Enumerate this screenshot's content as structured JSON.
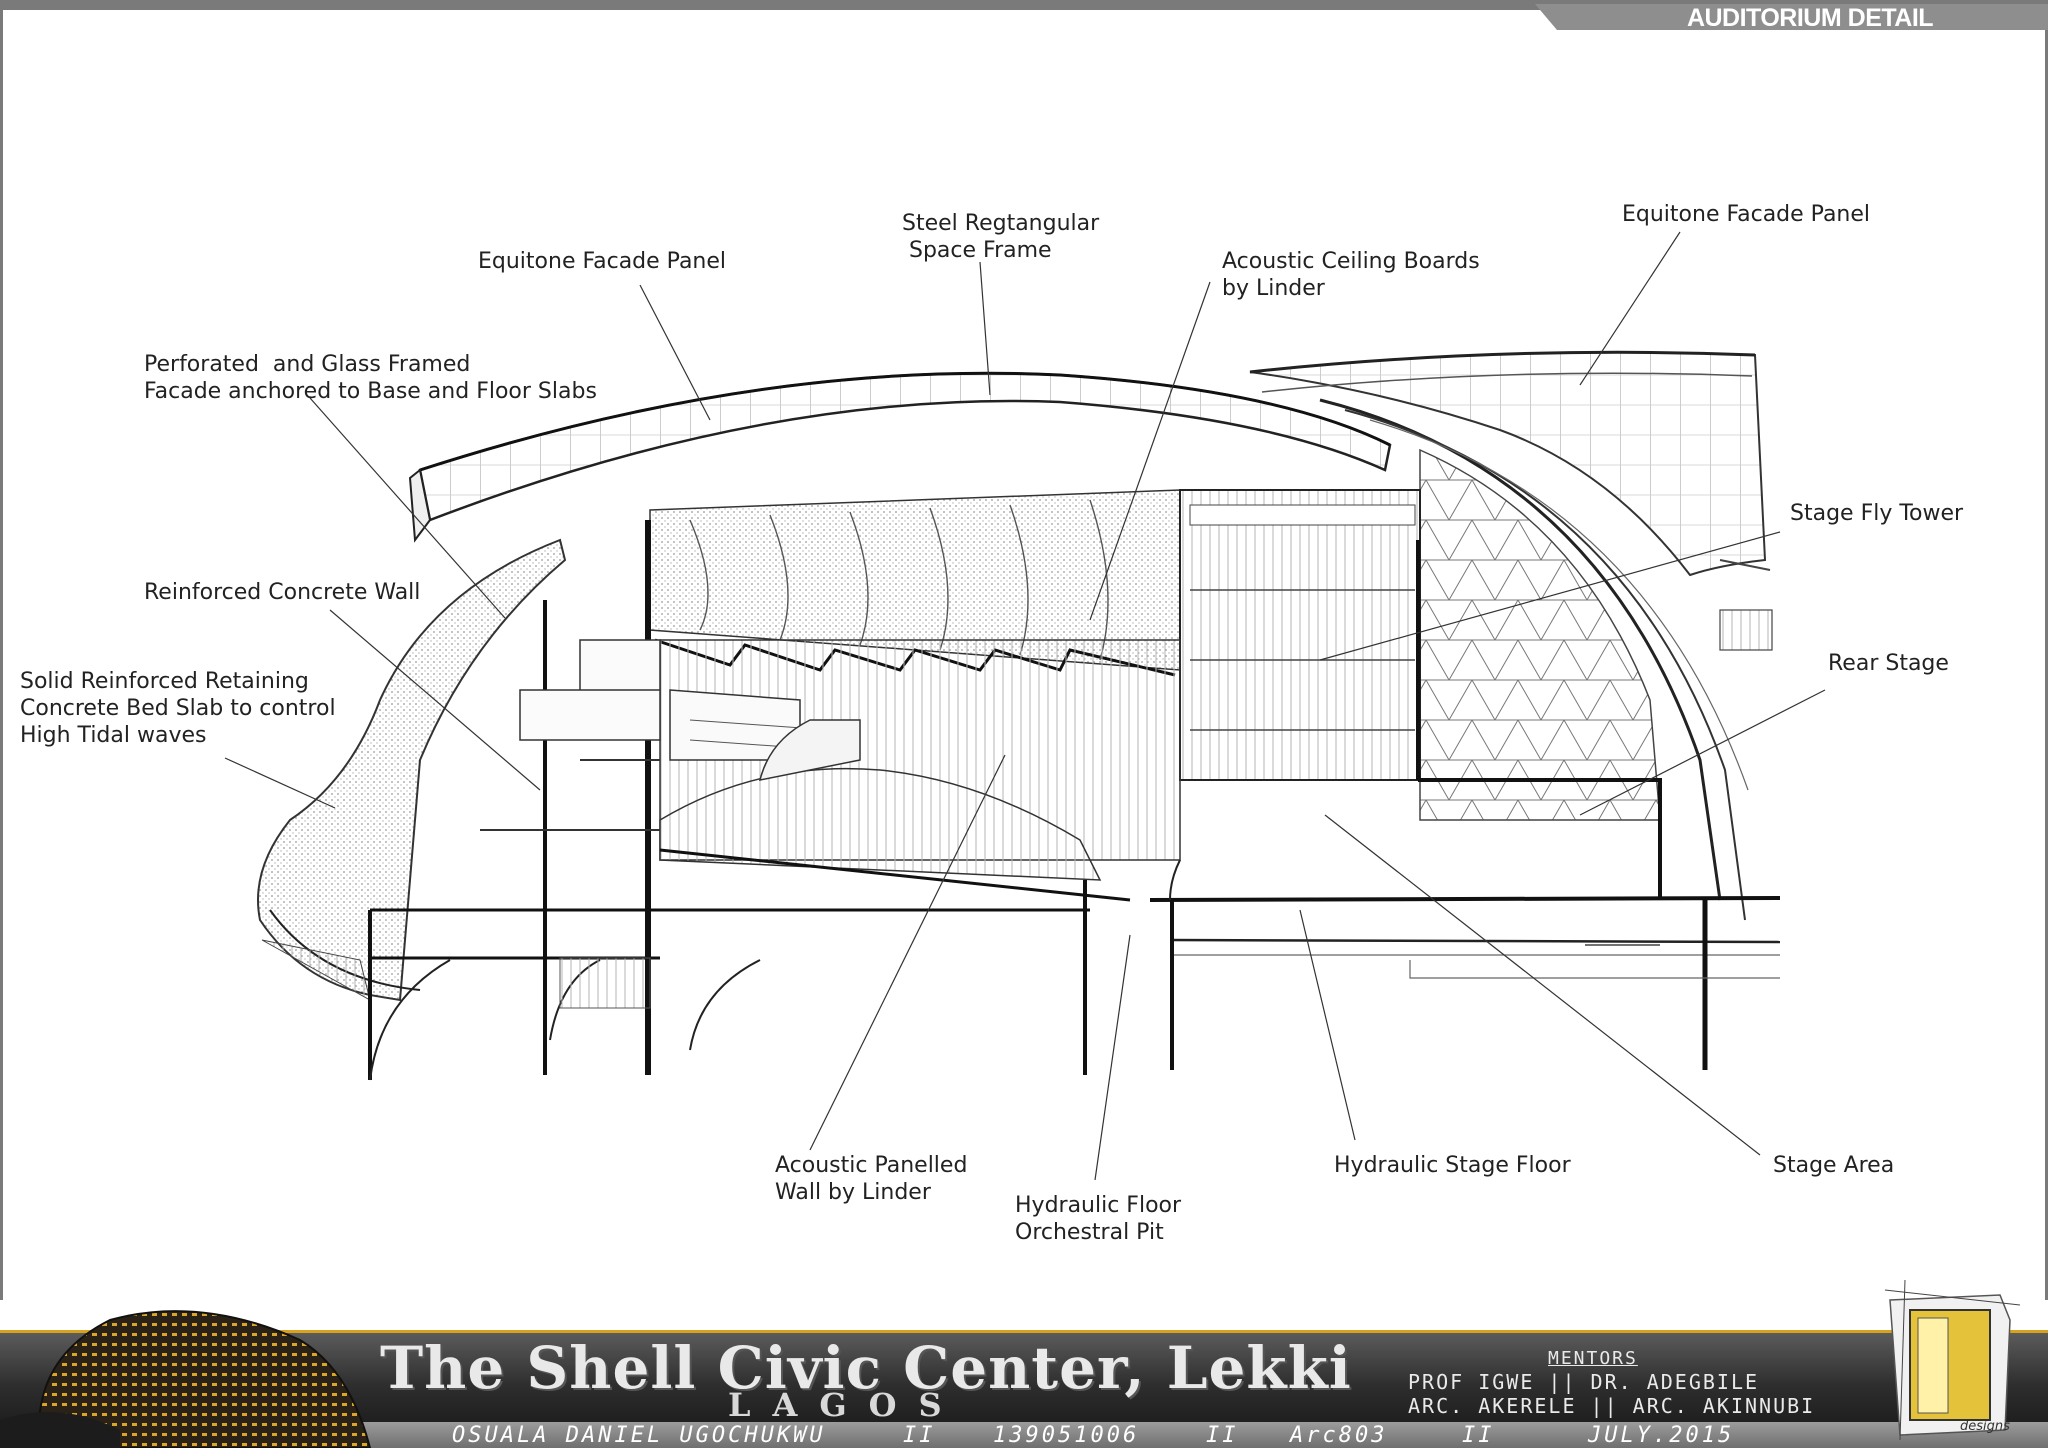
{
  "header": {
    "title": "AUDITORIUM DETAIL"
  },
  "callouts": [
    {
      "id": "equitone-left",
      "lines": [
        "Equitone Facade Panel"
      ]
    },
    {
      "id": "steel-frame",
      "lines": [
        "Steel Regtangular",
        " Space Frame"
      ]
    },
    {
      "id": "acoustic-ceiling",
      "lines": [
        "Acoustic Ceiling Boards",
        "by Linder"
      ]
    },
    {
      "id": "equitone-right",
      "lines": [
        "Equitone Facade Panel"
      ]
    },
    {
      "id": "perforated-facade",
      "lines": [
        "Perforated  and Glass Framed",
        "Facade anchored to Base and Floor Slabs"
      ]
    },
    {
      "id": "stage-fly-tower",
      "lines": [
        "Stage Fly Tower"
      ]
    },
    {
      "id": "concrete-wall",
      "lines": [
        "Reinforced Concrete Wall"
      ]
    },
    {
      "id": "rear-stage",
      "lines": [
        "Rear Stage"
      ]
    },
    {
      "id": "retaining-slab",
      "lines": [
        "Solid Reinforced Retaining",
        "Concrete Bed Slab to control",
        "High Tidal waves"
      ]
    },
    {
      "id": "acoustic-wall",
      "lines": [
        "Acoustic Panelled",
        "Wall by Linder"
      ]
    },
    {
      "id": "orchestral-pit",
      "lines": [
        "Hydraulic Floor",
        "Orchestral Pit"
      ]
    },
    {
      "id": "hydraulic-stage",
      "lines": [
        "Hydraulic Stage Floor"
      ]
    },
    {
      "id": "stage-area",
      "lines": [
        "Stage Area"
      ]
    }
  ],
  "footer": {
    "project_title": "The Shell Civic Center, Lekki",
    "project_location": "LAGOS",
    "mentors_heading": "MENTORS",
    "mentors_line1": "PROF IGWE || DR. ADEGBILE",
    "mentors_line2": "ARC. AKERELE || ARC. AKINNUBI",
    "student_name": "OSUALA DANIEL UGOCHUKWU",
    "sep": "II",
    "matric_number": "139051006",
    "course_code": "Arc803",
    "date": "JULY.2015",
    "logo_text": "designs"
  }
}
